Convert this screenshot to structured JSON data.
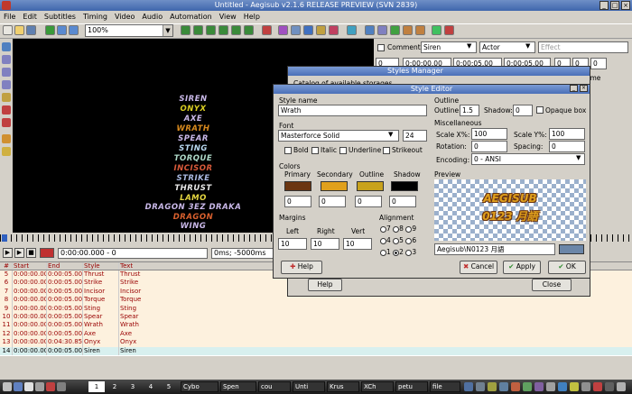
{
  "window": {
    "title": "Untitled - Aegisub v2.1.6 RELEASE PREVIEW (SVN 2839)"
  },
  "menu": [
    "File",
    "Edit",
    "Subtitles",
    "Timing",
    "Video",
    "Audio",
    "Automation",
    "View",
    "Help"
  ],
  "toolbar": {
    "zoom": "100%"
  },
  "video": {
    "lines": [
      {
        "text": "SIREN",
        "color": "#c9b8e8"
      },
      {
        "text": "ONYX",
        "color": "#d9cc22"
      },
      {
        "text": "AXE",
        "color": "#c9b8e8"
      },
      {
        "text": "WRATH",
        "color": "#d98a1e"
      },
      {
        "text": "SPEAR",
        "color": "#c9b8e8"
      },
      {
        "text": "STING",
        "color": "#b8d8f0"
      },
      {
        "text": "TORQUE",
        "color": "#aed9c8"
      },
      {
        "text": "INCISOR",
        "color": "#d95a3a"
      },
      {
        "text": "STRIKE",
        "color": "#a9b8e0"
      },
      {
        "text": "THRUST",
        "color": "#e9e9e9"
      },
      {
        "text": "LAMO",
        "color": "#e4d640"
      },
      {
        "text": "DRAGON 3EZ DRAKA",
        "color": "#c9b8e8"
      },
      {
        "text": "DRAGON",
        "color": "#d9602e"
      },
      {
        "text": "WING",
        "color": "#c9b8e8"
      }
    ]
  },
  "controls": {
    "time": "0:00:00.000 - 0",
    "ms": "0ms; -5000ms"
  },
  "grid": {
    "headers": [
      "#",
      "Start",
      "End",
      "Style",
      "Text"
    ],
    "rows": [
      {
        "n": "5",
        "start": "0:00:00.00",
        "end": "0:00:05.00",
        "style": "Thrust",
        "text": "Thrust"
      },
      {
        "n": "6",
        "start": "0:00:00.00",
        "end": "0:00:05.00",
        "style": "Strike",
        "text": "Strike"
      },
      {
        "n": "7",
        "start": "0:00:00.00",
        "end": "0:00:05.00",
        "style": "Incisor",
        "text": "Incisor"
      },
      {
        "n": "8",
        "start": "0:00:00.00",
        "end": "0:00:05.00",
        "style": "Torque",
        "text": "Torque"
      },
      {
        "n": "9",
        "start": "0:00:00.00",
        "end": "0:00:05.00",
        "style": "Sting",
        "text": "Sting"
      },
      {
        "n": "10",
        "start": "0:00:00.00",
        "end": "0:00:05.00",
        "style": "Spear",
        "text": "Spear"
      },
      {
        "n": "11",
        "start": "0:00:00.00",
        "end": "0:00:05.00",
        "style": "Wrath",
        "text": "Wrath"
      },
      {
        "n": "12",
        "start": "0:00:00.00",
        "end": "0:00:05.00",
        "style": "Axe",
        "text": "Axe"
      },
      {
        "n": "13",
        "start": "0:00:00.00",
        "end": "0:04:30.85",
        "style": "Onyx",
        "text": "Onyx"
      },
      {
        "n": "14",
        "start": "0:00:00.00",
        "end": "0:00:05.00",
        "style": "Siren",
        "text": "Siren"
      }
    ]
  },
  "edit": {
    "comment": "Comment",
    "style": "Siren",
    "actor": "Actor",
    "effect": "Effect",
    "layer": "0",
    "start": "0:00:00.00",
    "end": "0:00:05.00",
    "duration": "0:00:05.00",
    "m1": "0",
    "m2": "0",
    "m3": "0",
    "frame": "Frame"
  },
  "styles_manager": {
    "title": "Styles Manager",
    "catalog": "Catalog of available storages",
    "help": "Help",
    "close": "Close"
  },
  "style_editor": {
    "title": "Style Editor",
    "style_name_label": "Style name",
    "style_name": "Wrath",
    "font_label": "Font",
    "font_name": "Masterforce Solid",
    "font_size": "24",
    "bold": "Bold",
    "italic": "Italic",
    "underline": "Underline",
    "strikeout": "Strikeout",
    "colors_label": "Colors",
    "color_labels": [
      "Primary",
      "Secondary",
      "Outline",
      "Shadow"
    ],
    "colors": [
      "#6b3511",
      "#e0a01c",
      "#c8a21c",
      "#000000"
    ],
    "alphas": [
      "0",
      "0",
      "0",
      "0"
    ],
    "margins_label": "Margins",
    "margin_labels": [
      "Left",
      "Right",
      "Vert"
    ],
    "margins": [
      "10",
      "10",
      "10"
    ],
    "alignment_label": "Alignment",
    "alignment": [
      "7",
      "8",
      "9",
      "4",
      "5",
      "6",
      "1",
      "2",
      "3"
    ],
    "alignment_selected": "2",
    "outline_group": "Outline",
    "outline_label": "Outline:",
    "outline_value": "1.5",
    "shadow_label": "Shadow:",
    "shadow_value": "0",
    "opaque": "Opaque box",
    "misc_label": "Miscellaneous",
    "scalex_label": "Scale X%:",
    "scalex": "100",
    "scaley_label": "Scale Y%:",
    "scaley": "100",
    "rotation_label": "Rotation:",
    "rotation": "0",
    "spacing_label": "Spacing:",
    "spacing": "0",
    "encoding_label": "Encoding:",
    "encoding": "0 - ANSI",
    "preview_label": "Preview",
    "preview_line1": "AEGISUB",
    "preview_line2": "0123 月語",
    "preview_text": "Aegisub\\N0123 月語",
    "help": "Help",
    "cancel": "Cancel",
    "apply": "Apply",
    "ok": "OK"
  },
  "taskbar": {
    "workspaces": [
      "1",
      "2",
      "3",
      "4",
      "5"
    ],
    "tasks": [
      "Cybo",
      "Spen",
      "cou",
      "Unti",
      "Krus",
      "XCh",
      "petu",
      "file"
    ]
  }
}
